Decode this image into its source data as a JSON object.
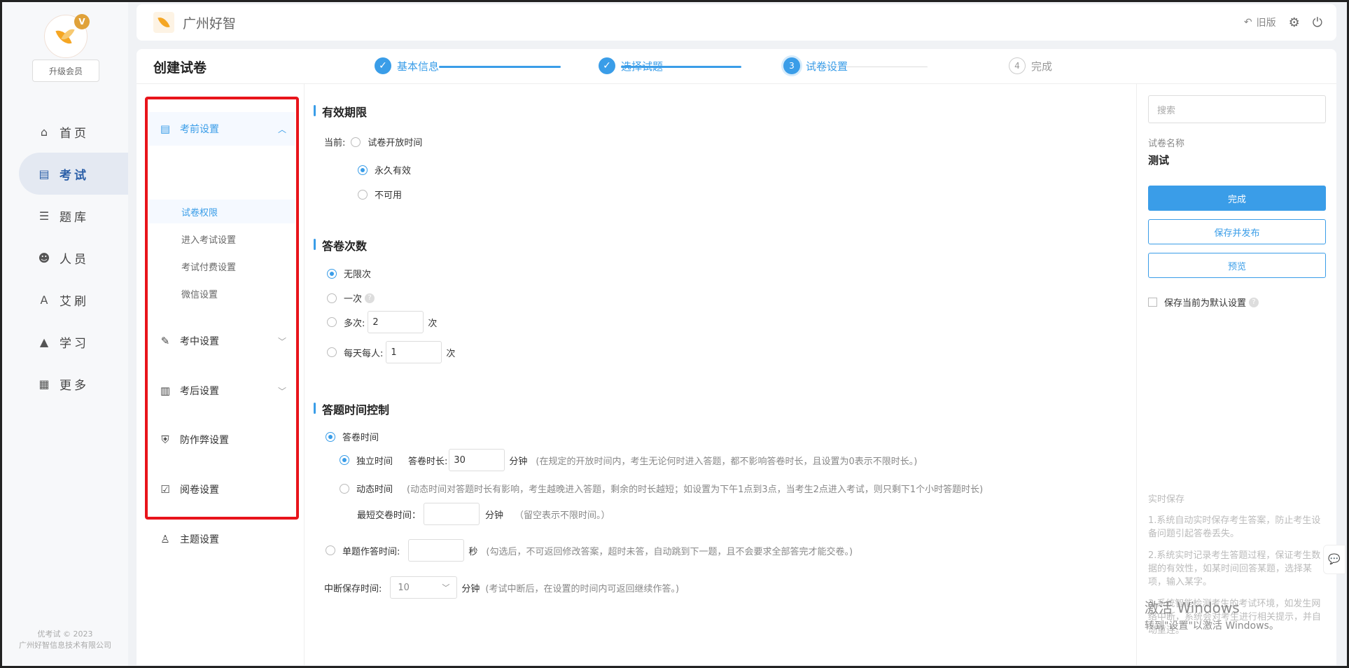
{
  "sidebar": {
    "badge": "V",
    "upgrade_label": "升级会员",
    "items": [
      {
        "label": "首页",
        "icon": "home-icon",
        "glyph": "⌂"
      },
      {
        "label": "考试",
        "icon": "exam-icon",
        "glyph": "▤"
      },
      {
        "label": "题库",
        "icon": "question-bank-icon",
        "glyph": "☰"
      },
      {
        "label": "人员",
        "icon": "person-icon",
        "glyph": "☻"
      },
      {
        "label": "艾刷",
        "icon": "ai-brush-icon",
        "glyph": "A"
      },
      {
        "label": "学习",
        "icon": "study-cap-icon",
        "glyph": "▲"
      },
      {
        "label": "更多",
        "icon": "more-grid-icon",
        "glyph": "▦"
      }
    ],
    "active_index": 1,
    "copyright_line1": "优考试 © 2023",
    "copyright_line2": "广州好智信息技术有限公司"
  },
  "topbar": {
    "app_name": "广州好智",
    "old_version_label": "旧版"
  },
  "page": {
    "title": "创建试卷"
  },
  "steps": [
    {
      "num": "✓",
      "label": "基本信息",
      "state": "done"
    },
    {
      "num": "✓",
      "label": "选择试题",
      "state": "done"
    },
    {
      "num": "3",
      "label": "试卷设置",
      "state": "current"
    },
    {
      "num": "4",
      "label": "完成",
      "state": "todo"
    }
  ],
  "settings_nav": {
    "groups": [
      {
        "label": "考前设置",
        "icon": "doc-icon",
        "glyph": "▤",
        "expanded": true
      },
      {
        "label": "考中设置",
        "icon": "edit-doc-icon",
        "glyph": "✎",
        "expanded": false
      },
      {
        "label": "考后设置",
        "icon": "score-doc-icon",
        "glyph": "▥",
        "expanded": false
      },
      {
        "label": "防作弊设置",
        "icon": "shield-icon",
        "glyph": "⛨",
        "expanded": false
      },
      {
        "label": "阅卷设置",
        "icon": "grading-icon",
        "glyph": "☑",
        "expanded": false
      },
      {
        "label": "主题设置",
        "icon": "shirt-icon",
        "glyph": "♙",
        "expanded": false
      }
    ],
    "sub_items": [
      "试卷权限",
      "进入考试设置",
      "考试付费设置",
      "微信设置"
    ],
    "active_sub": 0
  },
  "validity": {
    "title": "有效期限",
    "current_label": "当前:",
    "opt_open_time": "试卷开放时间",
    "opt_forever": "永久有效",
    "opt_unavailable": "不可用",
    "selected": "forever"
  },
  "attempts": {
    "title": "答卷次数",
    "unlimited": "无限次",
    "once": "一次",
    "multiple": "多次:",
    "multiple_value": "2",
    "unit": "次",
    "daily": "每天每人:",
    "daily_value": "1",
    "selected": "unlimited"
  },
  "time_control": {
    "title": "答题时间控制",
    "answer_time": "答卷时间",
    "independent": "独立时间",
    "duration_label": "答卷时长:",
    "duration_value": "30",
    "minute_unit": "分钟",
    "independent_hint": "(在规定的开放时间内，考生无论何时进入答题，都不影响答卷时长，且设置为0表示不限时长。)",
    "dynamic": "动态时间",
    "dynamic_hint": "(动态时间对答题时长有影响，考生越晚进入答题，剩余的时长越短；如设置为下午1点到3点，当考生2点进入考试，则只剩下1个小时答题时长)",
    "min_submit_label": "最短交卷时间：",
    "min_submit_value": "",
    "min_submit_hint": "（留空表示不限时间。）",
    "single_label": "单题作答时间:",
    "single_value": "",
    "second_unit": "秒",
    "single_hint": "(勾选后，不可返回修改答案，超时未答，自动跳到下一题，且不会要求全部答完才能交卷。)",
    "interrupt_label": "中断保存时间:",
    "interrupt_value": "10",
    "interrupt_hint": "(考试中断后，在设置的时间内可返回继续作答。)"
  },
  "right_panel": {
    "search_placeholder": "搜索",
    "name_label": "试卷名称",
    "name_value": "测试",
    "finish_btn": "完成",
    "save_publish_btn": "保存并发布",
    "preview_btn": "预览",
    "default_chk": "保存当前为默认设置",
    "realtime_title": "实时保存",
    "realtime_p1": "1.系统自动实时保存考生答案，防止考生设备问题引起答卷丢失。",
    "realtime_p2": "2.系统实时记录考生答题过程，保证考生数据的有效性，如某时间回答某题，选择某项，输入某字。",
    "realtime_p3": "3.系统智能检测考生的考试环境，如发生网络中断，系统会对考生进行相关提示，并自动重连。"
  },
  "watermark": {
    "line1": "激活 Windows",
    "line2": "转到\"设置\"以激活 Windows。"
  },
  "colors": {
    "accent": "#3a9de8",
    "highlight_box": "#e8141b",
    "brand_orange": "#f5a623"
  }
}
